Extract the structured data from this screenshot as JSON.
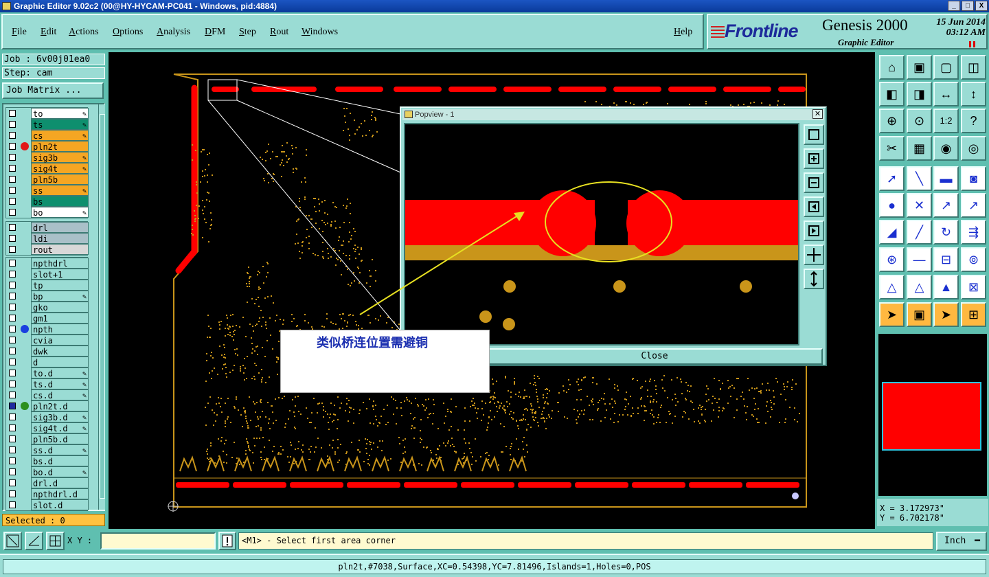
{
  "window": {
    "title": "Graphic Editor 9.02c2 (00@HY-HYCAM-PC041 - Windows, pid:4884)",
    "buttons": [
      "_",
      "□",
      "X"
    ]
  },
  "menu": {
    "items": [
      "File",
      "Edit",
      "Actions",
      "Options",
      "Analysis",
      "DFM",
      "Step",
      "Rout",
      "Windows"
    ],
    "help": "Help"
  },
  "brand": {
    "logo": "Frontline",
    "product": "Genesis 2000",
    "subtitle": "Graphic Editor",
    "date": "15 Jun 2014",
    "time": "03:12 AM"
  },
  "job": {
    "label": "Job : 6v00j01ea0",
    "step": "Step: cam",
    "matrix_button": "Job Matrix ..."
  },
  "layer_groups": [
    {
      "layers": [
        {
          "name": "to",
          "color": "#ffffff",
          "pen": true
        },
        {
          "name": "ts",
          "color": "#0e8f6e",
          "pen": true
        },
        {
          "name": "cs",
          "color": "#f5a623",
          "pen": true
        },
        {
          "name": "pln2t",
          "color": "#f5a623",
          "pen": false,
          "dot": "#e21818"
        },
        {
          "name": "sig3b",
          "color": "#f5a623",
          "pen": true
        },
        {
          "name": "sig4t",
          "color": "#f5a623",
          "pen": true
        },
        {
          "name": "pln5b",
          "color": "#f5a623",
          "pen": false
        },
        {
          "name": "ss",
          "color": "#f5a623",
          "pen": true
        },
        {
          "name": "bs",
          "color": "#0e8f6e",
          "pen": false
        },
        {
          "name": "bo",
          "color": "#ffffff",
          "pen": true
        }
      ]
    },
    {
      "layers": [
        {
          "name": "drl",
          "color": "#a9c0c8",
          "pen": false
        },
        {
          "name": "ldi",
          "color": "#a9c0c8",
          "pen": false
        },
        {
          "name": "rout",
          "color": "#d8d8d8",
          "pen": false
        }
      ]
    },
    {
      "layers": [
        {
          "name": "npthdrl",
          "color": "#9adcd4",
          "pen": false
        },
        {
          "name": "slot+1",
          "color": "#9adcd4",
          "pen": false
        },
        {
          "name": "tp",
          "color": "#9adcd4",
          "pen": false
        },
        {
          "name": "bp",
          "color": "#9adcd4",
          "pen": true
        },
        {
          "name": "gko",
          "color": "#9adcd4",
          "pen": false
        },
        {
          "name": "gm1",
          "color": "#9adcd4",
          "pen": false
        },
        {
          "name": "npth",
          "color": "#9adcd4",
          "pen": false,
          "dot": "#1a3fe0"
        },
        {
          "name": "cvia",
          "color": "#9adcd4",
          "pen": false
        },
        {
          "name": "dwk",
          "color": "#9adcd4",
          "pen": false
        },
        {
          "name": "d",
          "color": "#9adcd4",
          "pen": false
        },
        {
          "name": "to.d",
          "color": "#9adcd4",
          "pen": true
        },
        {
          "name": "ts.d",
          "color": "#9adcd4",
          "pen": true
        },
        {
          "name": "cs.d",
          "color": "#9adcd4",
          "pen": true
        },
        {
          "name": "pln2t.d",
          "color": "#9adcd4",
          "pen": false,
          "dot": "#2d8f1e",
          "selected": true
        },
        {
          "name": "sig3b.d",
          "color": "#9adcd4",
          "pen": true
        },
        {
          "name": "sig4t.d",
          "color": "#9adcd4",
          "pen": true
        },
        {
          "name": "pln5b.d",
          "color": "#9adcd4",
          "pen": false
        },
        {
          "name": "ss.d",
          "color": "#9adcd4",
          "pen": true
        },
        {
          "name": "bs.d",
          "color": "#9adcd4",
          "pen": false
        },
        {
          "name": "bo.d",
          "color": "#9adcd4",
          "pen": true
        },
        {
          "name": "drl.d",
          "color": "#9adcd4",
          "pen": false
        },
        {
          "name": "npthdrl.d",
          "color": "#9adcd4",
          "pen": false
        },
        {
          "name": "slot.d",
          "color": "#9adcd4",
          "pen": false
        }
      ]
    }
  ],
  "selected": "Selected : 0",
  "popview": {
    "title": "Popview - 1",
    "close": "Close"
  },
  "annotation": "类似桥连位置需避铜",
  "coords": {
    "x": "X = 3.172973\"",
    "y": "Y = 6.702178\""
  },
  "bottom": {
    "xy_label": "X Y :",
    "xy_value": "",
    "message": "<M1> - Select first area corner",
    "unit": "Inch"
  },
  "status": "pln2t,#7038,Surface,XC=0.54398,YC=7.81496,Islands=1,Holes=0,POS",
  "colors": {
    "copper": "#c9951a",
    "surface": "#ff0000",
    "background": "#000000",
    "teal": "#9adcd4"
  },
  "tool_icons": [
    "zoom-home-icon",
    "zoom-in-icon",
    "zoom-out-icon",
    "window-icon",
    "pan-left-icon",
    "pan-right-icon",
    "mirror-icon",
    "rotate-icon",
    "fit-icon",
    "center-icon",
    "one-to-one-icon",
    "help-icon",
    "measure-icon",
    "grid-icon",
    "snap-icon",
    "layers-icon",
    "cursor-icon",
    "line-icon",
    "ruler-icon",
    "pad-icon",
    "connect-icon",
    "cross-icon",
    "add-line-icon",
    "add-arc-icon",
    "slope-icon",
    "line-edit-icon",
    "arc-edit-icon",
    "net-icon",
    "pad-move-icon",
    "cut-icon",
    "dimension-icon",
    "shape-icon",
    "triangle-icon",
    "triangle-edit-icon",
    "triangle-fill-icon",
    "triangle-x-icon",
    "select-icon",
    "select-box-icon",
    "select-tri-icon",
    "select-net-icon"
  ]
}
